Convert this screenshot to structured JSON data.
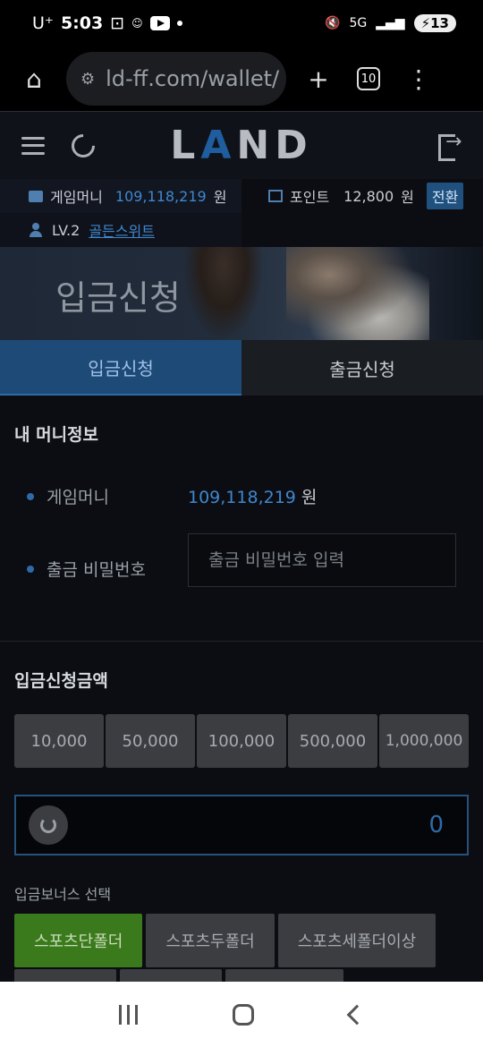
{
  "status_bar": {
    "carrier": "U⁺",
    "time": "5:03",
    "battery": "13",
    "network": "5G"
  },
  "browser": {
    "url": "ld-ff.com/wallet/",
    "tab_count": "10"
  },
  "header": {
    "logo_left": "L",
    "logo_accent": "A",
    "logo_right": "ND"
  },
  "info": {
    "game_money_label": "게임머니",
    "game_money_value": "109,118,219",
    "game_money_unit": "원",
    "point_label": "포인트",
    "point_value": "12,800",
    "point_unit": "원",
    "convert_label": "전환",
    "level": "LV.2",
    "level_name": "골든스위트"
  },
  "banner": {
    "title": "입금신청"
  },
  "tabs": [
    {
      "label": "입금신청",
      "active": true
    },
    {
      "label": "출금신청",
      "active": false
    }
  ],
  "money_info": {
    "section_title": "내 머니정보",
    "game_money_label": "게임머니",
    "game_money_value": "109,118,219",
    "game_money_unit": "원",
    "password_label": "출금 비밀번호",
    "password_placeholder": "출금 비밀번호 입력"
  },
  "deposit": {
    "section_title": "입금신청금액",
    "amounts": [
      "10,000",
      "50,000",
      "100,000",
      "500,000",
      "1,000,000"
    ],
    "amount_value": "0",
    "bonus_title": "입금보너스 선택",
    "bonus_options": [
      "스포츠단폴더",
      "스포츠두폴더",
      "스포츠세폴더이상"
    ],
    "selected_bonus": "스포츠단폴더"
  },
  "colors": {
    "accent_blue": "#3f87cf",
    "active_tab": "#1e4a78",
    "selected_bonus": "#3b7a1c",
    "page_bg": "#0b0d12"
  }
}
